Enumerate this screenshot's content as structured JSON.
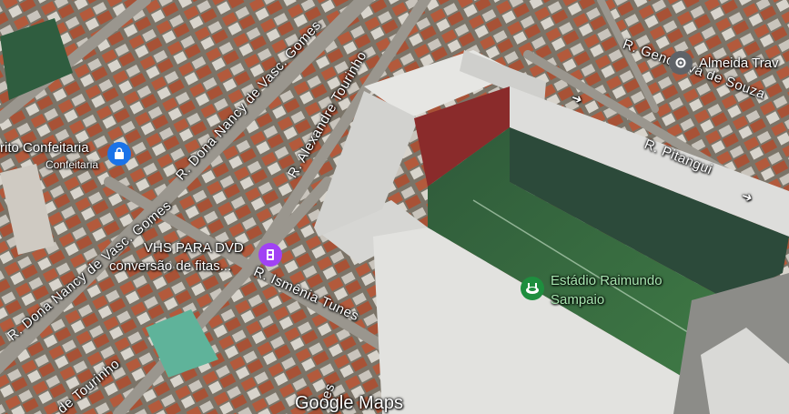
{
  "map": {
    "streets": {
      "s1": "R. Dona Nancy de Vasc. Gomes",
      "s2": "R. Alexandre Tourinho",
      "s3": "R. Genoveva de Souza",
      "s4": "R. Pitangui",
      "s5": "R. Dona Nancy de Vasc. Gomes",
      "s6": "R. Ismênia Tunes",
      "s7": "de Tourinho",
      "s8": "res"
    },
    "places": {
      "confeitaria": {
        "name": "rito Confeitaria",
        "category": "Confeitaria",
        "icon": "shopping-bag-icon",
        "color": "#1a73e8"
      },
      "vhs": {
        "name": "VHS PARA DVD",
        "subtitle": "conversão de fitas...",
        "icon": "film-icon",
        "color": "#a142f4"
      },
      "stadium": {
        "name": "Estádio Raimundo",
        "name2": "Sampaio",
        "icon": "stadium-icon",
        "color": "#1e8e3e"
      },
      "almeida": {
        "name": "Almeida Trav",
        "icon": "location-pin-icon",
        "color": "#5f6368"
      }
    },
    "watermark": "Google Maps"
  }
}
